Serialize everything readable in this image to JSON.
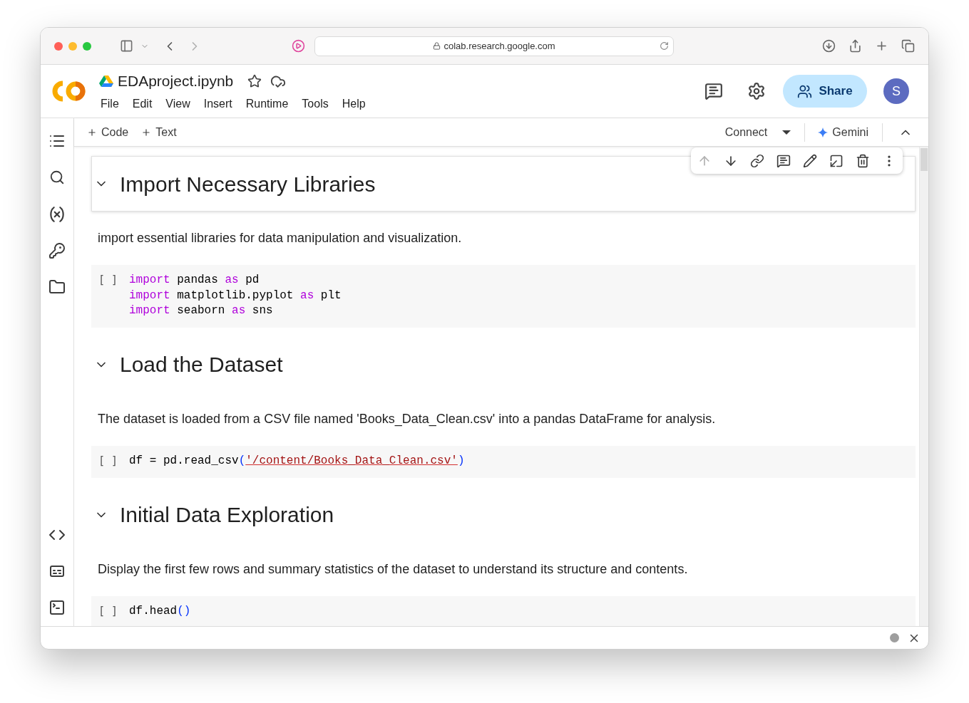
{
  "browser": {
    "url": "colab.research.google.com"
  },
  "notebook": {
    "title": "EDAproject.ipynb",
    "starred": false,
    "menu": [
      "File",
      "Edit",
      "View",
      "Insert",
      "Runtime",
      "Tools",
      "Help"
    ]
  },
  "header": {
    "share": "Share",
    "avatar": "S"
  },
  "toolbar": {
    "add": [
      "Code",
      "Text"
    ],
    "connect": "Connect",
    "gemini": "Gemini"
  },
  "cell_toolbar": [
    {
      "kind": "up",
      "disabled": true
    },
    {
      "kind": "down",
      "disabled": false
    },
    {
      "kind": "link",
      "disabled": false
    },
    {
      "kind": "comment",
      "disabled": false
    },
    {
      "kind": "edit",
      "disabled": false
    },
    {
      "kind": "mirror",
      "disabled": false
    },
    {
      "kind": "delete",
      "disabled": false
    },
    {
      "kind": "more",
      "disabled": false
    }
  ],
  "sections": [
    {
      "heading": "Import Necessary Libraries",
      "selected": true,
      "expanded": true,
      "description": "import essential libraries for data manipulation and visualization.",
      "code": {
        "prompt": "[ ]",
        "lines": [
          [
            {
              "kind": "keyword",
              "text": "import"
            },
            {
              "kind": "plain",
              "text": " pandas "
            },
            {
              "kind": "keyword",
              "text": "as"
            },
            {
              "kind": "plain",
              "text": " pd"
            }
          ],
          [
            {
              "kind": "keyword",
              "text": "import"
            },
            {
              "kind": "plain",
              "text": " matplotlib.pyplot "
            },
            {
              "kind": "keyword",
              "text": "as"
            },
            {
              "kind": "plain",
              "text": " plt"
            }
          ],
          [
            {
              "kind": "keyword",
              "text": "import"
            },
            {
              "kind": "plain",
              "text": " seaborn "
            },
            {
              "kind": "keyword",
              "text": "as"
            },
            {
              "kind": "plain",
              "text": " sns"
            }
          ]
        ]
      }
    },
    {
      "heading": "Load the Dataset",
      "selected": false,
      "expanded": true,
      "description": "The dataset is loaded from a CSV file named 'Books_Data_Clean.csv' into a pandas DataFrame for analysis.",
      "code": {
        "prompt": "[ ]",
        "lines": [
          [
            {
              "kind": "plain",
              "text": "df = pd.read_csv"
            },
            {
              "kind": "paren",
              "text": "("
            },
            {
              "kind": "string",
              "text": "'/content/Books_Data_Clean.csv'"
            },
            {
              "kind": "paren",
              "text": ")"
            }
          ]
        ]
      }
    },
    {
      "heading": "Initial Data Exploration",
      "selected": false,
      "expanded": true,
      "description": "Display the first few rows and summary statistics of the dataset to understand its structure and contents.",
      "code": {
        "prompt": "[ ]",
        "lines": [
          [
            {
              "kind": "plain",
              "text": "df.head"
            },
            {
              "kind": "paren",
              "text": "()"
            }
          ]
        ]
      }
    }
  ]
}
